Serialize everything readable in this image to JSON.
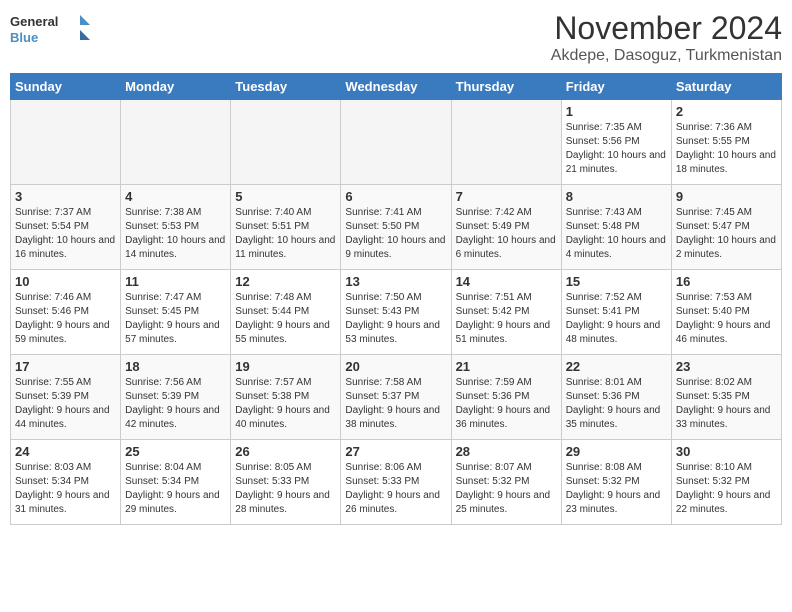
{
  "logo": {
    "line1": "General",
    "line2": "Blue"
  },
  "title": "November 2024",
  "subtitle": "Akdepe, Dasoguz, Turkmenistan",
  "days_of_week": [
    "Sunday",
    "Monday",
    "Tuesday",
    "Wednesday",
    "Thursday",
    "Friday",
    "Saturday"
  ],
  "weeks": [
    [
      {
        "day": "",
        "info": ""
      },
      {
        "day": "",
        "info": ""
      },
      {
        "day": "",
        "info": ""
      },
      {
        "day": "",
        "info": ""
      },
      {
        "day": "",
        "info": ""
      },
      {
        "day": "1",
        "info": "Sunrise: 7:35 AM\nSunset: 5:56 PM\nDaylight: 10 hours and 21 minutes."
      },
      {
        "day": "2",
        "info": "Sunrise: 7:36 AM\nSunset: 5:55 PM\nDaylight: 10 hours and 18 minutes."
      }
    ],
    [
      {
        "day": "3",
        "info": "Sunrise: 7:37 AM\nSunset: 5:54 PM\nDaylight: 10 hours and 16 minutes."
      },
      {
        "day": "4",
        "info": "Sunrise: 7:38 AM\nSunset: 5:53 PM\nDaylight: 10 hours and 14 minutes."
      },
      {
        "day": "5",
        "info": "Sunrise: 7:40 AM\nSunset: 5:51 PM\nDaylight: 10 hours and 11 minutes."
      },
      {
        "day": "6",
        "info": "Sunrise: 7:41 AM\nSunset: 5:50 PM\nDaylight: 10 hours and 9 minutes."
      },
      {
        "day": "7",
        "info": "Sunrise: 7:42 AM\nSunset: 5:49 PM\nDaylight: 10 hours and 6 minutes."
      },
      {
        "day": "8",
        "info": "Sunrise: 7:43 AM\nSunset: 5:48 PM\nDaylight: 10 hours and 4 minutes."
      },
      {
        "day": "9",
        "info": "Sunrise: 7:45 AM\nSunset: 5:47 PM\nDaylight: 10 hours and 2 minutes."
      }
    ],
    [
      {
        "day": "10",
        "info": "Sunrise: 7:46 AM\nSunset: 5:46 PM\nDaylight: 9 hours and 59 minutes."
      },
      {
        "day": "11",
        "info": "Sunrise: 7:47 AM\nSunset: 5:45 PM\nDaylight: 9 hours and 57 minutes."
      },
      {
        "day": "12",
        "info": "Sunrise: 7:48 AM\nSunset: 5:44 PM\nDaylight: 9 hours and 55 minutes."
      },
      {
        "day": "13",
        "info": "Sunrise: 7:50 AM\nSunset: 5:43 PM\nDaylight: 9 hours and 53 minutes."
      },
      {
        "day": "14",
        "info": "Sunrise: 7:51 AM\nSunset: 5:42 PM\nDaylight: 9 hours and 51 minutes."
      },
      {
        "day": "15",
        "info": "Sunrise: 7:52 AM\nSunset: 5:41 PM\nDaylight: 9 hours and 48 minutes."
      },
      {
        "day": "16",
        "info": "Sunrise: 7:53 AM\nSunset: 5:40 PM\nDaylight: 9 hours and 46 minutes."
      }
    ],
    [
      {
        "day": "17",
        "info": "Sunrise: 7:55 AM\nSunset: 5:39 PM\nDaylight: 9 hours and 44 minutes."
      },
      {
        "day": "18",
        "info": "Sunrise: 7:56 AM\nSunset: 5:39 PM\nDaylight: 9 hours and 42 minutes."
      },
      {
        "day": "19",
        "info": "Sunrise: 7:57 AM\nSunset: 5:38 PM\nDaylight: 9 hours and 40 minutes."
      },
      {
        "day": "20",
        "info": "Sunrise: 7:58 AM\nSunset: 5:37 PM\nDaylight: 9 hours and 38 minutes."
      },
      {
        "day": "21",
        "info": "Sunrise: 7:59 AM\nSunset: 5:36 PM\nDaylight: 9 hours and 36 minutes."
      },
      {
        "day": "22",
        "info": "Sunrise: 8:01 AM\nSunset: 5:36 PM\nDaylight: 9 hours and 35 minutes."
      },
      {
        "day": "23",
        "info": "Sunrise: 8:02 AM\nSunset: 5:35 PM\nDaylight: 9 hours and 33 minutes."
      }
    ],
    [
      {
        "day": "24",
        "info": "Sunrise: 8:03 AM\nSunset: 5:34 PM\nDaylight: 9 hours and 31 minutes."
      },
      {
        "day": "25",
        "info": "Sunrise: 8:04 AM\nSunset: 5:34 PM\nDaylight: 9 hours and 29 minutes."
      },
      {
        "day": "26",
        "info": "Sunrise: 8:05 AM\nSunset: 5:33 PM\nDaylight: 9 hours and 28 minutes."
      },
      {
        "day": "27",
        "info": "Sunrise: 8:06 AM\nSunset: 5:33 PM\nDaylight: 9 hours and 26 minutes."
      },
      {
        "day": "28",
        "info": "Sunrise: 8:07 AM\nSunset: 5:32 PM\nDaylight: 9 hours and 25 minutes."
      },
      {
        "day": "29",
        "info": "Sunrise: 8:08 AM\nSunset: 5:32 PM\nDaylight: 9 hours and 23 minutes."
      },
      {
        "day": "30",
        "info": "Sunrise: 8:10 AM\nSunset: 5:32 PM\nDaylight: 9 hours and 22 minutes."
      }
    ]
  ]
}
